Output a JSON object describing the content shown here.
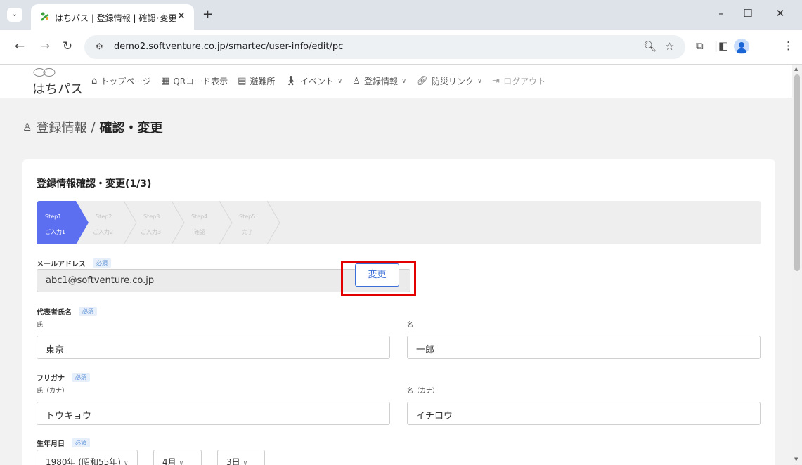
{
  "browser": {
    "tab_title": "はちパス | 登録情報 | 確認･変更",
    "url": "demo2.softventure.co.jp/smartec/user-info/edit/pc"
  },
  "header": {
    "logo_text": "はちパス",
    "nav": [
      {
        "label": "トップページ",
        "icon": "home-icon"
      },
      {
        "label": "QRコード表示",
        "icon": "qr-code-icon"
      },
      {
        "label": "避難所",
        "icon": "building-icon"
      },
      {
        "label": "イベント",
        "icon": "walking-person-icon",
        "dropdown": true
      },
      {
        "label": "登録情報",
        "icon": "user-icon",
        "dropdown": true
      },
      {
        "label": "防災リンク",
        "icon": "link-icon",
        "dropdown": true
      },
      {
        "label": "ログアウト",
        "icon": "logout-icon"
      }
    ]
  },
  "breadcrumb": {
    "parent": "登録情報",
    "separator": "/",
    "current": "確認・変更"
  },
  "card": {
    "title": "登録情報確認・変更(1/3)",
    "steps": [
      {
        "label": "Step1",
        "sub": "ご入力1",
        "active": true
      },
      {
        "label": "Step2",
        "sub": "ご入力2",
        "active": false
      },
      {
        "label": "Step3",
        "sub": "ご入力3",
        "active": false
      },
      {
        "label": "Step4",
        "sub": "確認",
        "active": false
      },
      {
        "label": "Step5",
        "sub": "完了",
        "active": false
      }
    ]
  },
  "form": {
    "required_badge": "必須",
    "email": {
      "label": "メールアドレス",
      "value": "abc1@softventure.co.jp",
      "button": "変更"
    },
    "name": {
      "label": "代表者氏名",
      "last_label": "氏",
      "first_label": "名",
      "last_value": "東京",
      "first_value": "一郎"
    },
    "kana": {
      "label": "フリガナ",
      "last_label": "氏（カナ）",
      "first_label": "名（カナ）",
      "last_value": "トウキョウ",
      "first_value": "イチロウ"
    },
    "birthday": {
      "label": "生年月日",
      "year": "1980年 (昭和55年)",
      "month": "4月",
      "day": "3日"
    }
  },
  "colors": {
    "accent": "#5b6ff0",
    "button": "#3b6fd8",
    "highlight": "#e30000"
  }
}
